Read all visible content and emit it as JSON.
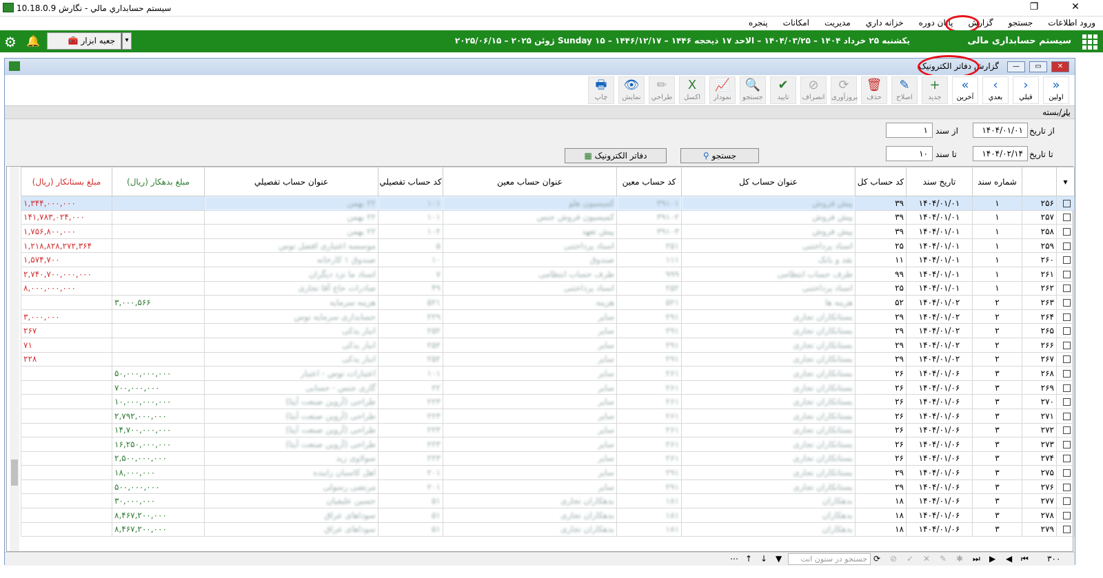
{
  "app": {
    "title": "سیستم حسابداري مالي - نگارش 10.18.0.9"
  },
  "menu": [
    "ورود اطلاعات",
    "جستجو",
    "گزارش",
    "پايان دوره",
    "خزانه داري",
    "مديريت",
    "امكانات",
    "پنجره"
  ],
  "header": {
    "brand": "سیستم حسابداری مالی",
    "date": "يكشنبه ۲۵ خرداد ۱۴۰۴ – ۱۴۰۴/۰۳/۲۵ – الاحد ۱۷ ذيحجه ۱۴۴۶ – ۱۴۴۶/۱۲/۱۷ – Sunday ۱۵ ژوئن ۲۰۲۵ – ۲۰۲۵/۰۶/۱۵",
    "toolbox": "جعبه ابزار"
  },
  "window": {
    "title_prefix": "گزارش",
    "title": "دفاتر الكترونيک"
  },
  "toolbar": [
    {
      "label": "اولين",
      "icon": "»"
    },
    {
      "label": "قبلي",
      "icon": "›"
    },
    {
      "label": "بعدي",
      "icon": "‹"
    },
    {
      "label": "آخرين",
      "icon": "«"
    },
    {
      "label": "جديد",
      "icon": "+"
    },
    {
      "label": "اصلاح",
      "icon": "✎"
    },
    {
      "label": "حذف",
      "icon": "🗑"
    },
    {
      "label": "بروزآوری",
      "icon": "⟳"
    },
    {
      "label": "انصراف",
      "icon": "⊘"
    },
    {
      "label": "تاييد",
      "icon": "✔"
    },
    {
      "label": "جستجو",
      "icon": "🔍"
    },
    {
      "label": "نمودار",
      "icon": "📈"
    },
    {
      "label": "اكسل",
      "icon": "X"
    },
    {
      "label": "طراحي",
      "icon": "✏"
    },
    {
      "label": "نمايش",
      "icon": "👁"
    },
    {
      "label": "چاپ",
      "icon": "🖶"
    }
  ],
  "group_label": "باز/بسته",
  "filters": {
    "from_date_label": "از تاريخ",
    "from_date": "۱۴۰۴/۰۱/۰۱",
    "from_doc_label": "از سند",
    "from_doc": "۱",
    "to_date_label": "تا تاريخ",
    "to_date": "۱۴۰۴/۰۲/۱۴",
    "to_doc_label": "تا سند",
    "to_doc": "۱۰",
    "search_btn": "جستجو",
    "ledger_btn": "دفاتر الكترونيک"
  },
  "columns": [
    "شماره سند",
    "تاريخ سند",
    "كد حساب كل",
    "عنوان حساب كل",
    "كد حساب معين",
    "عنوان حساب معين",
    "كد حساب تفصيلي",
    "عنوان حساب تفصيلي",
    "مبلغ بدهكار (ريال)",
    "مبلغ بستانكار (ريال)"
  ],
  "rows": [
    {
      "n": "۲۵۶",
      "doc": "۱",
      "date": "۱۴۰۴/۰۱/۰۱",
      "kc": "۳۹",
      "kt": "پیش فروش",
      "mc": "۳۹۱۰۱",
      "mt": "کمیسیون هلو",
      "tc": "۱۰۱",
      "tt": "۲۲ بهمن",
      "deb": "",
      "cred": "۱,۳۴۴,۰۰۰,۰۰۰"
    },
    {
      "n": "۲۵۷",
      "doc": "۱",
      "date": "۱۴۰۴/۰۱/۰۱",
      "kc": "۳۹",
      "kt": "پیش فروش",
      "mc": "۳۹۱۰۲",
      "mt": "کمیسیون فروش جنس",
      "tc": "۱۰۱",
      "tt": "۲۲ بهمن",
      "deb": "",
      "cred": "۱۴۱,۷۸۳,۰۲۴,۰۰۰"
    },
    {
      "n": "۲۵۸",
      "doc": "۱",
      "date": "۱۴۰۴/۰۱/۰۱",
      "kc": "۳۹",
      "kt": "پیش فروش",
      "mc": "۳۹۱۰۳",
      "mt": "پیش تعهد",
      "tc": "۱۰۲",
      "tt": "۲۲ بهمن",
      "deb": "",
      "cred": "۱,۷۵۶,۸۰۰,۰۰۰"
    },
    {
      "n": "۲۵۹",
      "doc": "۱",
      "date": "۱۴۰۴/۰۱/۰۱",
      "kc": "۲۵",
      "kt": "اسناد پرداختنی",
      "mc": "۲۵۱",
      "mt": "اسناد پرداختنی",
      "tc": "۵",
      "tt": "موسسه اعتباری افضل توس",
      "deb": "",
      "cred": "۱,۲۱۸,۸۲۸,۲۷۲,۳۶۴"
    },
    {
      "n": "۲۶۰",
      "doc": "۱",
      "date": "۱۴۰۴/۰۱/۰۱",
      "kc": "۱۱",
      "kt": "نقد و بانک",
      "mc": "۱۱۱",
      "mt": "صندوق",
      "tc": "۱۰",
      "tt": "صندوق ۱ کارخانه",
      "deb": "",
      "cred": "۱,۵۷۴,۷۰۰"
    },
    {
      "n": "۲۶۱",
      "doc": "۱",
      "date": "۱۴۰۴/۰۱/۰۱",
      "kc": "۹۹",
      "kt": "طرف حساب انتظامی",
      "mc": "۹۹۹",
      "mt": "طرف حساب انتظامی",
      "tc": "۷",
      "tt": "اسناد ما نزد دیگران",
      "deb": "",
      "cred": "۲,۷۴۰,۷۰۰,۰۰۰,۰۰۰"
    },
    {
      "n": "۲۶۲",
      "doc": "۱",
      "date": "۱۴۰۴/۰۱/۰۱",
      "kc": "۲۵",
      "kt": "اسناد پرداختنی",
      "mc": "۲۵۲",
      "mt": "اسناد پرداختنی",
      "tc": "۴۹",
      "tt": "صادرات حاج آقا تجاری",
      "deb": "",
      "cred": "۸,۰۰۰,۰۰۰,۰۰۰"
    },
    {
      "n": "۲۶۳",
      "doc": "۲",
      "date": "۱۴۰۴/۰۱/۰۲",
      "kc": "۵۲",
      "kt": "هزینه ها",
      "mc": "۵۲۱",
      "mt": "هزینه",
      "tc": "۵۲۱",
      "tt": "هزینه سرمایه",
      "deb": "۳,۰۰۰,۵۶۶",
      "cred": ""
    },
    {
      "n": "۲۶۴",
      "doc": "۲",
      "date": "۱۴۰۴/۰۱/۰۲",
      "kc": "۲۹",
      "kt": "بستانکاران تجاری",
      "mc": "۲۹۱",
      "mt": "سایر",
      "tc": "۲۲۹",
      "tt": "حسابداری سرمایه توس",
      "deb": "",
      "cred": "۳,۰۰۰,۰۰۰"
    },
    {
      "n": "۲۶۵",
      "doc": "۲",
      "date": "۱۴۰۴/۰۱/۰۲",
      "kc": "۲۹",
      "kt": "بستانکاران تجاری",
      "mc": "۲۹۱",
      "mt": "سایر",
      "tc": "۲۵۲",
      "tt": "انبار یدکی",
      "deb": "",
      "cred": "۲۶۷"
    },
    {
      "n": "۲۶۶",
      "doc": "۲",
      "date": "۱۴۰۴/۰۱/۰۲",
      "kc": "۲۹",
      "kt": "بستانکاران تجاری",
      "mc": "۲۹۱",
      "mt": "سایر",
      "tc": "۲۵۲",
      "tt": "انبار یدکی",
      "deb": "",
      "cred": "۷۱"
    },
    {
      "n": "۲۶۷",
      "doc": "۲",
      "date": "۱۴۰۴/۰۱/۰۲",
      "kc": "۲۹",
      "kt": "بستانکاران تجاری",
      "mc": "۲۹۱",
      "mt": "سایر",
      "tc": "۲۵۲",
      "tt": "انبار یدکی",
      "deb": "",
      "cred": "۲۲۸"
    },
    {
      "n": "۲۶۸",
      "doc": "۳",
      "date": "۱۴۰۴/۰۱/۰۶",
      "kc": "۲۶",
      "kt": "بستانکاران تجاری",
      "mc": "۲۶۱",
      "mt": "سایر",
      "tc": "۱۰۱",
      "tt": "اعتبارات توس - اعتبار",
      "deb": "۵۰,۰۰۰,۰۰۰,۰۰۰",
      "cred": ""
    },
    {
      "n": "۲۶۹",
      "doc": "۳",
      "date": "۱۴۰۴/۰۱/۰۶",
      "kc": "۲۶",
      "kt": "بستانکاران تجاری",
      "mc": "۲۶۱",
      "mt": "سایر",
      "tc": "۲۲",
      "tt": "گاری جنس - حسابی",
      "deb": "۷۰۰,۰۰۰,۰۰۰",
      "cred": ""
    },
    {
      "n": "۲۷۰",
      "doc": "۳",
      "date": "۱۴۰۴/۰۱/۰۶",
      "kc": "۲۶",
      "kt": "بستانکاران تجاری",
      "mc": "۲۶۱",
      "mt": "سایر",
      "tc": "۲۲۳",
      "tt": "طراحی (آروین صنعت آیتا)",
      "deb": "۱۰,۰۰۰,۰۰۰,۰۰۰",
      "cred": ""
    },
    {
      "n": "۲۷۱",
      "doc": "۳",
      "date": "۱۴۰۴/۰۱/۰۶",
      "kc": "۲۶",
      "kt": "بستانکاران تجاری",
      "mc": "۲۶۱",
      "mt": "سایر",
      "tc": "۲۲۳",
      "tt": "طراحی (آروین صنعت آیتا)",
      "deb": "۲,۷۹۲,۰۰۰,۰۰۰",
      "cred": ""
    },
    {
      "n": "۲۷۲",
      "doc": "۳",
      "date": "۱۴۰۴/۰۱/۰۶",
      "kc": "۲۶",
      "kt": "بستانکاران تجاری",
      "mc": "۲۶۱",
      "mt": "سایر",
      "tc": "۲۲۳",
      "tt": "طراحی (آروین صنعت آیتا)",
      "deb": "۱۴,۷۰۰,۰۰۰,۰۰۰",
      "cred": ""
    },
    {
      "n": "۲۷۳",
      "doc": "۳",
      "date": "۱۴۰۴/۰۱/۰۶",
      "kc": "۲۶",
      "kt": "بستانکاران تجاری",
      "mc": "۲۶۱",
      "mt": "سایر",
      "tc": "۲۲۳",
      "tt": "طراحی (آروین صنعت آیتا)",
      "deb": "۱۶,۲۵۰,۰۰۰,۰۰۰",
      "cred": ""
    },
    {
      "n": "۲۷۴",
      "doc": "۳",
      "date": "۱۴۰۴/۰۱/۰۶",
      "kc": "۲۶",
      "kt": "بستانکاران تجاری",
      "mc": "۲۶۱",
      "mt": "سایر",
      "tc": "۲۲۳",
      "tt": "سولاوی زید",
      "deb": "۲,۵۰۰,۰۰۰,۰۰۰",
      "cred": ""
    },
    {
      "n": "۲۷۵",
      "doc": "۳",
      "date": "۱۴۰۴/۰۱/۰۶",
      "kc": "۲۹",
      "kt": "بستانکاران تجاری",
      "mc": "۲۹۱",
      "mt": "سایر",
      "tc": "۲۰۱",
      "tt": "اهل کاسبان زاینده",
      "deb": "۱۸,۰۰۰,۰۰۰",
      "cred": ""
    },
    {
      "n": "۲۷۶",
      "doc": "۳",
      "date": "۱۴۰۴/۰۱/۰۶",
      "kc": "۲۹",
      "kt": "بستانکاران تجاری",
      "mc": "۲۹۱",
      "mt": "سایر",
      "tc": "۲۰۱",
      "tt": "مرتضی رسولی",
      "deb": "۵۰۰,۰۰۰,۰۰۰",
      "cred": ""
    },
    {
      "n": "۲۷۷",
      "doc": "۳",
      "date": "۱۴۰۴/۰۱/۰۶",
      "kc": "۱۸",
      "kt": "بدهکاران",
      "mc": "۱۸۱",
      "mt": "بدهکاران تجاری",
      "tc": "۵۱",
      "tt": "حسین علیفیان",
      "deb": "۳۰,۰۰۰,۰۰۰",
      "cred": ""
    },
    {
      "n": "۲۷۸",
      "doc": "۳",
      "date": "۱۴۰۴/۰۱/۰۶",
      "kc": "۱۸",
      "kt": "بدهکاران",
      "mc": "۱۸۱",
      "mt": "بدهکاران تجاری",
      "tc": "۵۱",
      "tt": "سوداهای عراق",
      "deb": "۸,۴۶۷,۲۰۰,۰۰۰",
      "cred": ""
    },
    {
      "n": "۲۷۹",
      "doc": "۳",
      "date": "۱۴۰۴/۰۱/۰۶",
      "kc": "۱۸",
      "kt": "بدهکاران",
      "mc": "۱۸۱",
      "mt": "بدهکاران تجاری",
      "tc": "۵۱",
      "tt": "سوداهای عراق",
      "deb": "۸,۴۶۷,۲۰۰,۰۰۰",
      "cred": ""
    }
  ],
  "footer": {
    "count": "۳۰۰",
    "search_placeholder": "جستجو در ستون انت"
  }
}
